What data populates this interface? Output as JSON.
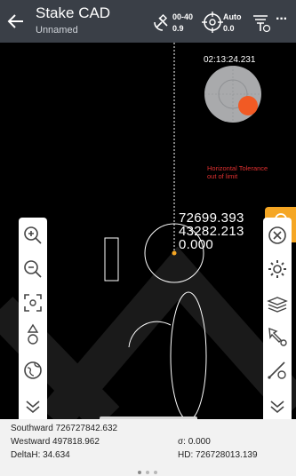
{
  "header": {
    "title": "Stake CAD",
    "subtitle": "Unnamed",
    "solution_top": "00-40",
    "solution_bottom": "0.9",
    "mode_top": "Auto",
    "mode_bottom": "0.0",
    "more_label": "···"
  },
  "map": {
    "time": "02:13:24.231",
    "warning": "Horizontal Tolerance out of limit",
    "readout": {
      "north": "72699.393",
      "east": "43282.213",
      "height": "0.000"
    }
  },
  "left_toolbar": [
    "zoom-in",
    "zoom-out",
    "locate-center",
    "layers-stack",
    "globe",
    "collapse-down"
  ],
  "right_toolbar": [
    "close",
    "settings",
    "layer-stack",
    "select-point",
    "stake-line",
    "collapse-down"
  ],
  "bottom_panel": {
    "southward": "Southward 726727842.632",
    "westward": "Westward 497818.962",
    "delta_h": "DeltaH: 34.634",
    "sigma": "σ: 0.000",
    "hd": "HD: 726728013.139",
    "page_count": 3,
    "active_page": 0
  },
  "colors": {
    "header_bg": "#3a3f47",
    "accent": "#f5a623",
    "warning": "#e03030",
    "target": "#f15a24"
  }
}
